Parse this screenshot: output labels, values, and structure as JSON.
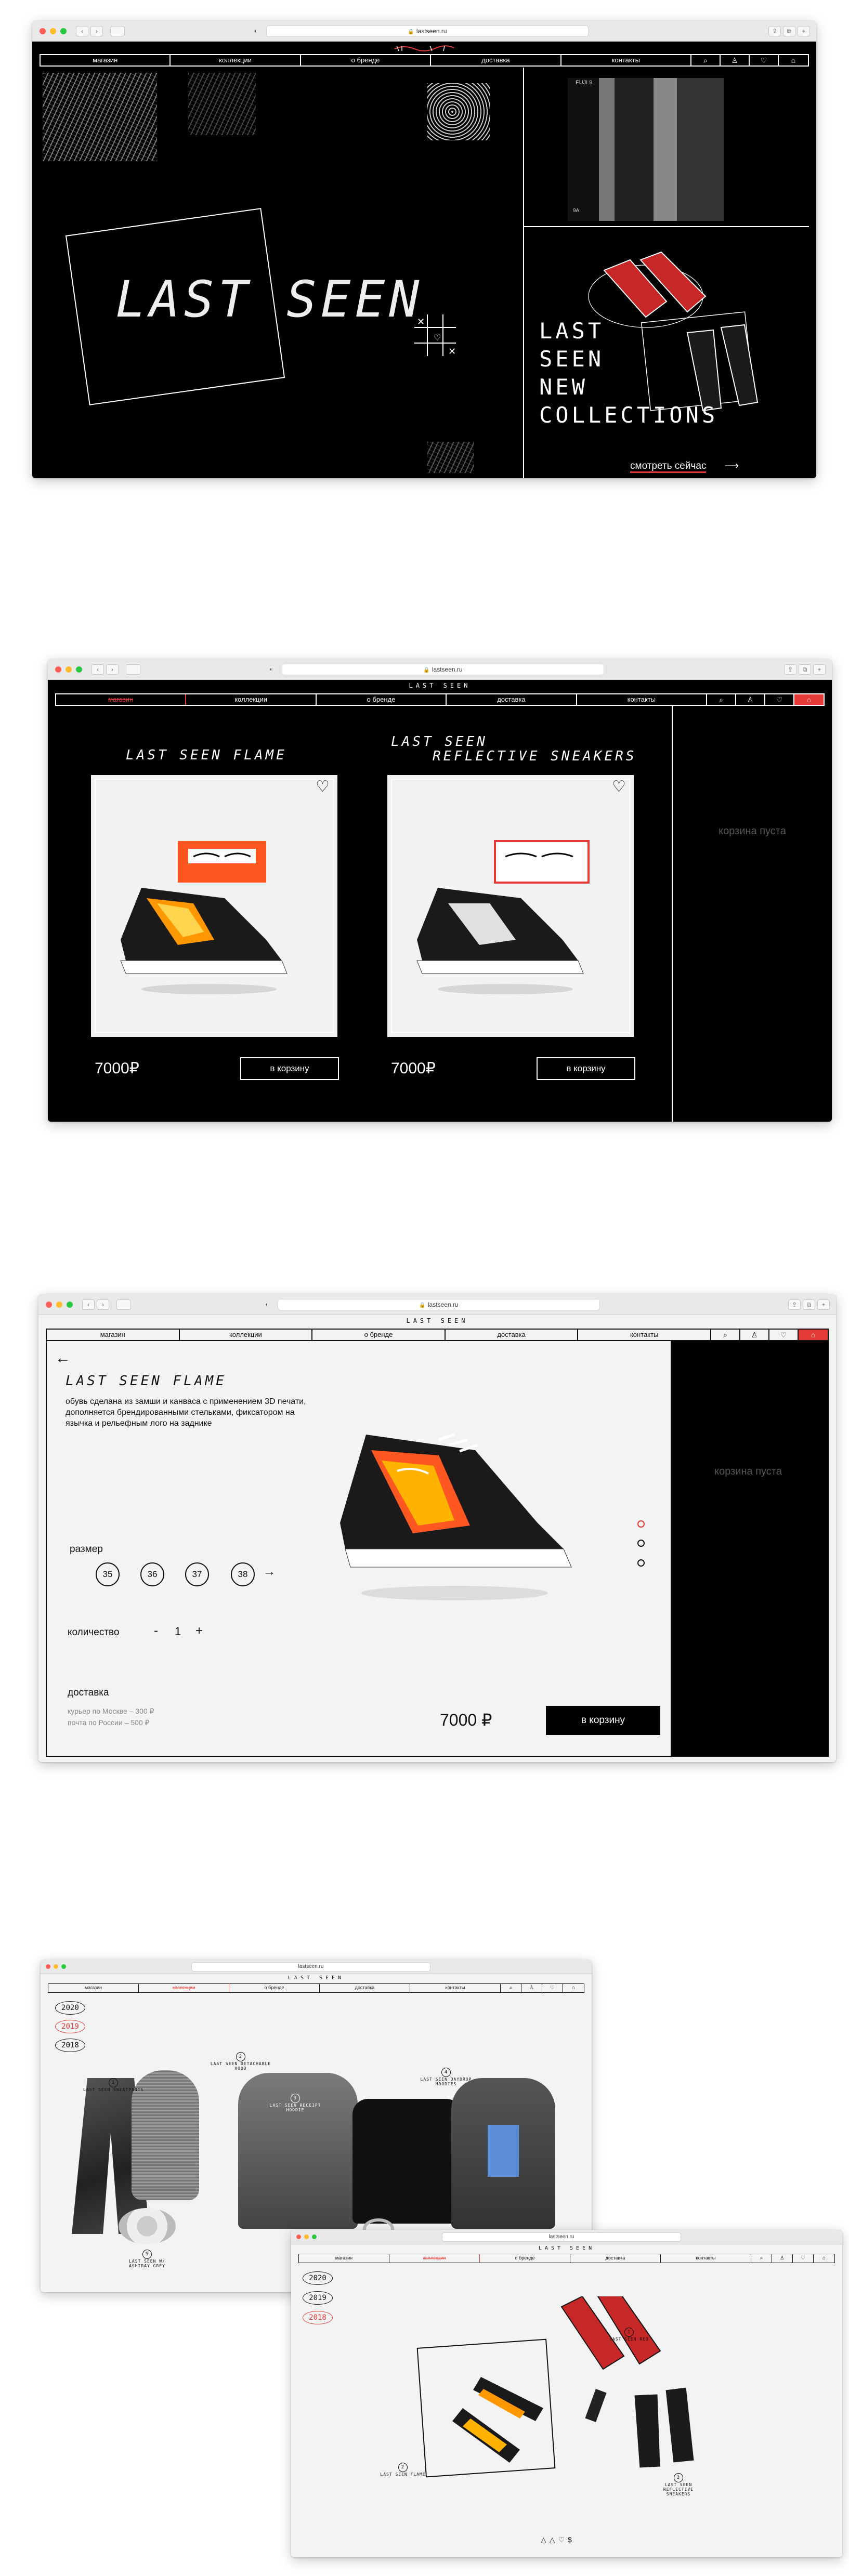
{
  "url": "lastseen.ru",
  "colors": {
    "accent": "#e53935",
    "dark": "#000000",
    "light": "#f3f3f3"
  },
  "nav": {
    "items": [
      "магазин",
      "коллекции",
      "о бренде",
      "доставка",
      "контакты"
    ],
    "icons": [
      "search-icon",
      "account-icon",
      "heart-icon",
      "cart-icon"
    ]
  },
  "brand": "LAST SEEN",
  "hero": {
    "logo": "LAST SEEN",
    "headline_lines": [
      "LAST",
      "SEEN",
      "NEW",
      "COLLECTIONS"
    ],
    "cta": "смотреть сейчас",
    "film_label_1": "FUJI 9",
    "film_label_2": "9A"
  },
  "catalog": {
    "cart_empty": "корзина пуста",
    "products": [
      {
        "title": "LAST SEEN FLAME",
        "price": "7000₽",
        "button": "в корзину"
      },
      {
        "title_line1": "LAST SEEN",
        "title_line2": "REFLECTIVE SNEAKERS",
        "price": "7000₽",
        "button": "в корзину"
      }
    ]
  },
  "product": {
    "back": "←",
    "title": "LAST SEEN FLAME",
    "description": "обувь сделана из замши и канваса с применением 3D печати, дополняется брендированными стельками, фиксатором на язычка и рельефным лого на заднике",
    "size_label": "размер",
    "sizes": [
      "35",
      "36",
      "37",
      "38"
    ],
    "size_next": "→",
    "qty_label": "количество",
    "qty_minus": "-",
    "qty_value": "1",
    "qty_plus": "+",
    "delivery_label": "доставка",
    "delivery_moscow": "курьер по Москве – 300 ₽",
    "delivery_russia": "почта по России – 500 ₽",
    "price": "7000 ₽",
    "button": "в корзину",
    "cart_empty": "корзина пуста"
  },
  "collections": {
    "years": [
      "2020",
      "2019",
      "2018"
    ],
    "active_year_a": "2019",
    "active_year_b": "2018",
    "tags_a": [
      {
        "num": "1",
        "label": "LAST SEEN SWEATPANTS"
      },
      {
        "num": "2",
        "label": "LAST SEEN DETACHABLE HOOD"
      },
      {
        "num": "3",
        "label": "LAST SEEN RECEIPT HOODIE"
      },
      {
        "num": "4",
        "label": "LAST SEEN DAYDROP HOODIES"
      },
      {
        "num": "5",
        "label": "LAST SEEN W/ ASHTRAY GREY"
      }
    ],
    "tags_b": [
      {
        "num": "1",
        "label": "LAST SEEN RED"
      },
      {
        "num": "2",
        "label": "LAST SEEN FLAME"
      },
      {
        "num": "3",
        "label": "LAST SEEN REFLECTIVE SNEAKERS"
      }
    ]
  }
}
